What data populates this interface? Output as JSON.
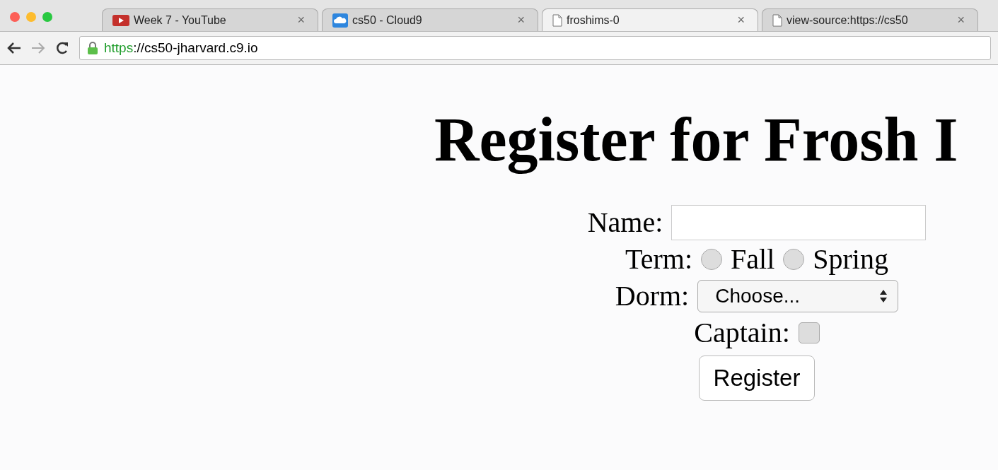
{
  "browser": {
    "tabs": [
      {
        "title": "Week 7 - YouTube",
        "close": "×",
        "selected": false
      },
      {
        "title": "cs50 - Cloud9",
        "close": "×",
        "selected": false
      },
      {
        "title": "froshims-0",
        "close": "×",
        "selected": true
      },
      {
        "title": "view-source:https://cs50",
        "close": "×",
        "selected": false
      }
    ],
    "address": {
      "scheme": "https",
      "rest": "://cs50-jharvard.c9.io"
    }
  },
  "page": {
    "heading": "Register for Frosh I",
    "form": {
      "name_label": "Name:",
      "term_label": "Term:",
      "terms": [
        {
          "label": "Fall",
          "selected": false
        },
        {
          "label": "Spring",
          "selected": false
        }
      ],
      "dorm_label": "Dorm:",
      "dorm_value": "Choose...",
      "captain_label": "Captain:",
      "captain_checked": false,
      "submit": "Register"
    }
  }
}
